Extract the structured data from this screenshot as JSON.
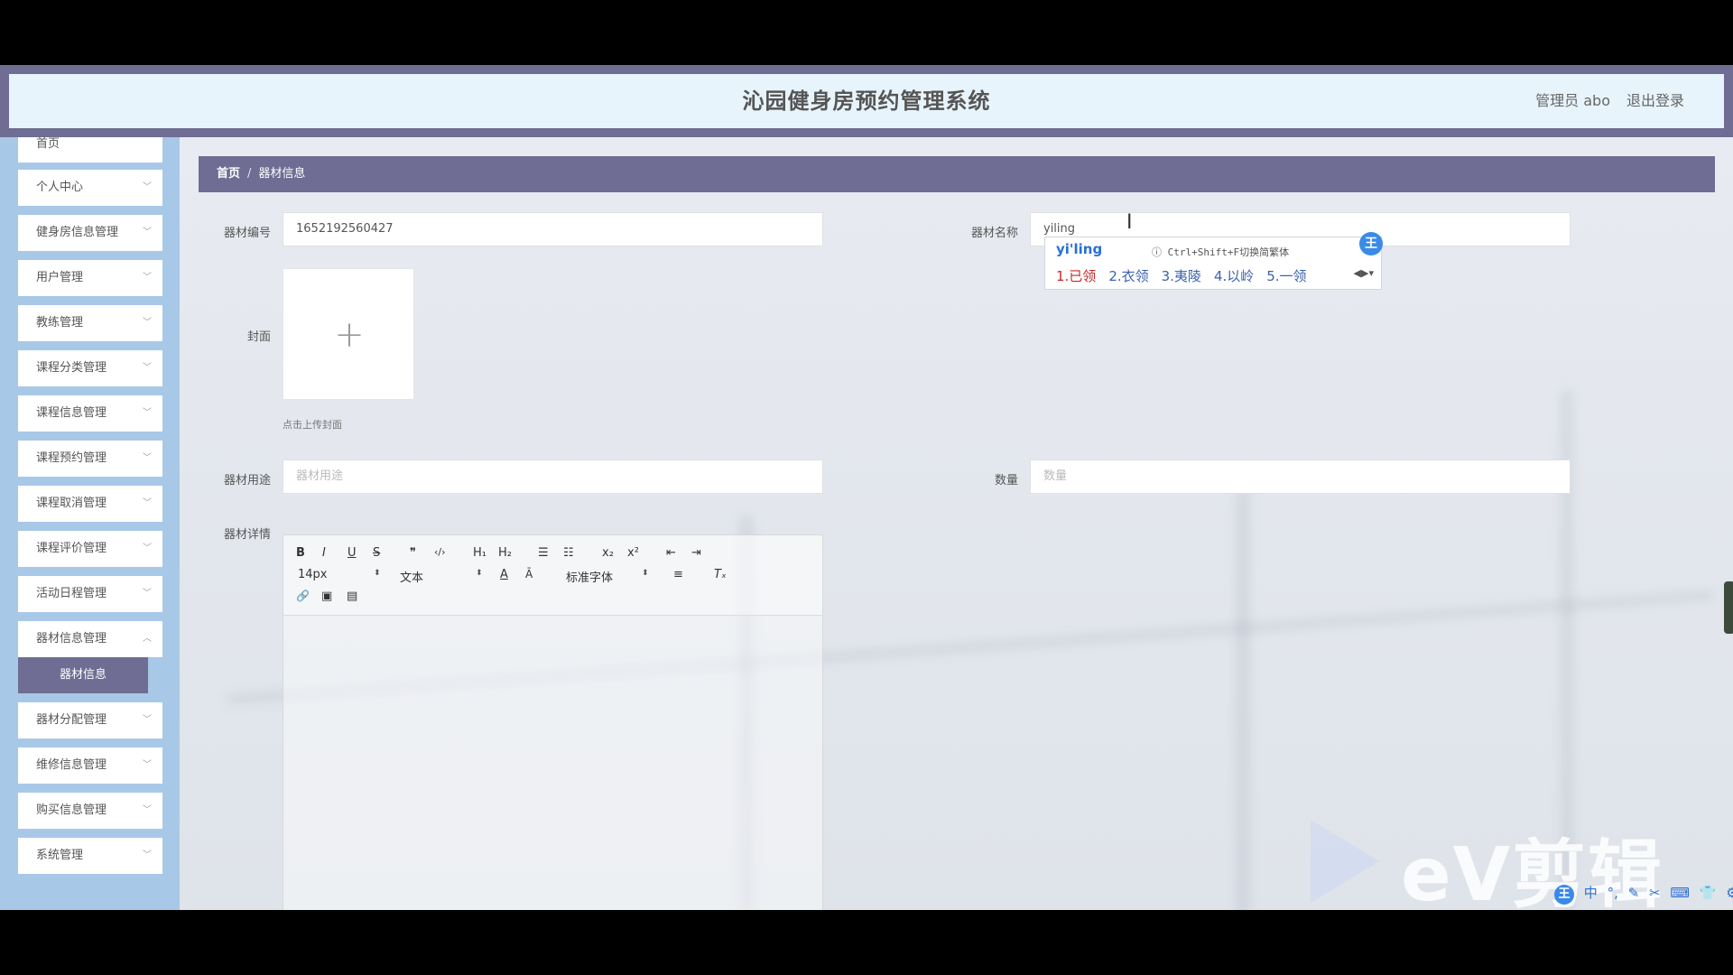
{
  "header": {
    "title": "沁园健身房预约管理系统",
    "user": "管理员 abo",
    "logout": "退出登录"
  },
  "sidebar": {
    "items": [
      {
        "label": "首页"
      },
      {
        "label": "个人中心"
      },
      {
        "label": "健身房信息管理"
      },
      {
        "label": "用户管理"
      },
      {
        "label": "教练管理"
      },
      {
        "label": "课程分类管理"
      },
      {
        "label": "课程信息管理"
      },
      {
        "label": "课程预约管理"
      },
      {
        "label": "课程取消管理"
      },
      {
        "label": "课程评价管理"
      },
      {
        "label": "活动日程管理"
      },
      {
        "label": "器材信息管理"
      },
      {
        "label": "器材分配管理"
      },
      {
        "label": "维修信息管理"
      },
      {
        "label": "购买信息管理"
      },
      {
        "label": "系统管理"
      }
    ],
    "active_sub": "器材信息"
  },
  "breadcrumb": {
    "home": "首页",
    "separator": "/",
    "current": "器材信息"
  },
  "form": {
    "code_label": "器材编号",
    "code_value": "1652192560427",
    "name_label": "器材名称",
    "name_value": "yiling",
    "cover_label": "封面",
    "cover_hint": "点击上传封面",
    "usage_label": "器材用途",
    "usage_placeholder": "器材用途",
    "qty_label": "数量",
    "qty_placeholder": "数量",
    "detail_label": "器材详情"
  },
  "editor": {
    "font_size": "14px",
    "header_select": "文本",
    "font_family": "标准字体",
    "tools": {
      "bold": "B",
      "italic": "I",
      "underline": "U",
      "strike": "S",
      "quote": "❞",
      "code": "‹/›",
      "h1": "H₁",
      "h2": "H₂",
      "ol": "☰",
      "ul": "☷",
      "sub": "x₂",
      "sup": "x²",
      "outdent": "⇤",
      "indent": "⇥",
      "color": "A",
      "background": "Ā",
      "align": "≡",
      "clean": "Tₓ",
      "link": "🔗",
      "image": "▣",
      "video": "▤"
    }
  },
  "ime": {
    "composition": "yi'ling",
    "hint": "Ctrl+Shift+F切换简繁体",
    "badge": "王",
    "candidates": [
      "1.已领",
      "2.衣领",
      "3.夷陵",
      "4.以岭",
      "5.一领"
    ]
  },
  "watermark": "eV剪辑",
  "taskbar": {
    "badge": "王",
    "items": [
      "中",
      "°,",
      "✎",
      "✂",
      "⌨",
      "👕",
      "⚙"
    ]
  }
}
